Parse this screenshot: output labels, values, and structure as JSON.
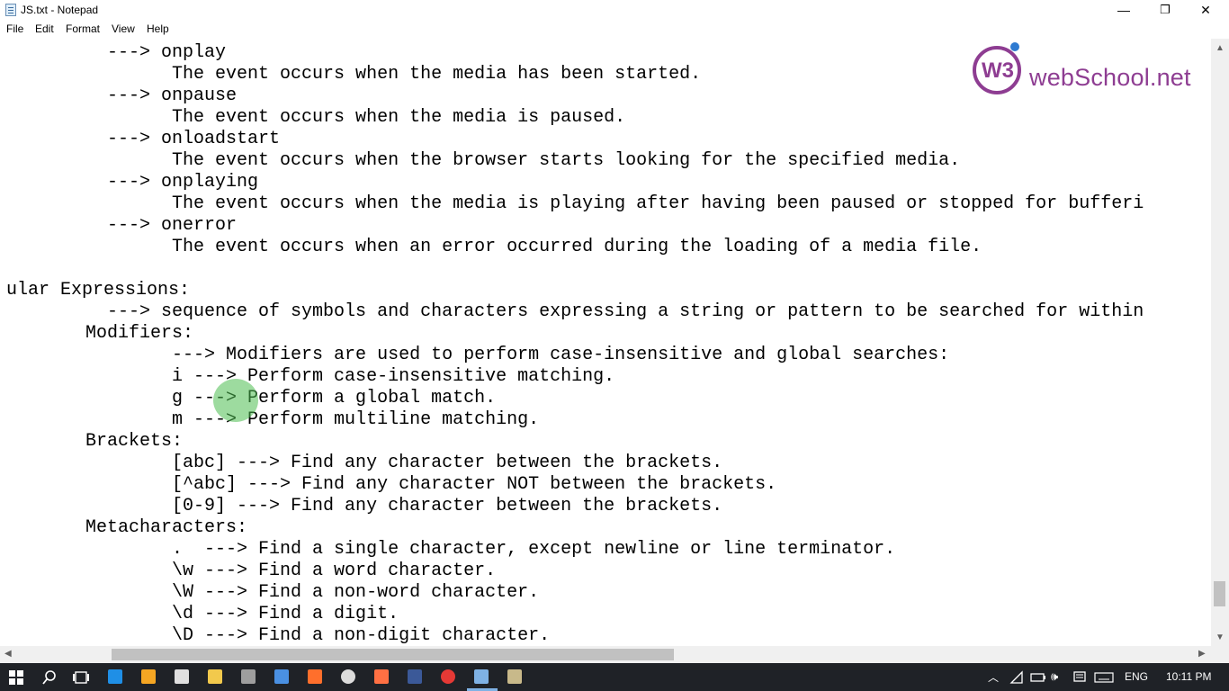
{
  "window": {
    "title": "JS.txt - Notepad",
    "minimize": "—",
    "maximize": "❐",
    "close": "✕"
  },
  "menu": [
    "File",
    "Edit",
    "Format",
    "View",
    "Help"
  ],
  "lines": [
    "        ---> onplay",
    "              The event occurs when the media has been started.",
    "        ---> onpause",
    "              The event occurs when the media is paused.",
    "        ---> onloadstart",
    "              The event occurs when the browser starts looking for the specified media.",
    "        ---> onplaying",
    "              The event occurs when the media is playing after having been paused or stopped for bufferi",
    "        ---> onerror",
    "              The event occurs when an error occurred during the loading of a media file.",
    "",
    "ular Expressions:",
    "        ---> sequence of symbols and characters expressing a string or pattern to be searched for within",
    "      Modifiers:",
    "              ---> Modifiers are used to perform case-insensitive and global searches:",
    "              i ---> Perform case-insensitive matching.",
    "              g ---> Perform a global match.",
    "              m ---> Perform multiline matching.",
    "      Brackets:",
    "              [abc] ---> Find any character between the brackets.",
    "              [^abc] ---> Find any character NOT between the brackets.",
    "              [0-9] ---> Find any character between the brackets.",
    "      Metacharacters:",
    "              .  ---> Find a single character, except newline or line terminator.",
    "              \\w ---> Find a word character.",
    "              \\W ---> Find a non-word character.",
    "              \\d ---> Find a digit.",
    "              \\D ---> Find a non-digit character."
  ],
  "logo": {
    "mark": "W3",
    "text": "webSchool.net"
  },
  "taskbar": {
    "language": "ENG",
    "time": "10:11 PM"
  },
  "icons": {
    "start": "windows-start-icon",
    "search": "search-icon",
    "taskview": "task-view-icon",
    "apps": [
      "edge-icon",
      "media-player-icon",
      "store-icon",
      "file-explorer-icon",
      "film-icon",
      "window-icon",
      "paint-icon",
      "chrome-alt-icon",
      "fox-icon",
      "facebook-icon",
      "chrome-icon",
      "notepad-icon",
      "terminal-icon"
    ],
    "tray": [
      "chevron-up-icon",
      "wifi-icon",
      "battery-icon",
      "volume-icon",
      "message-icon",
      "keyboard-icon"
    ]
  }
}
